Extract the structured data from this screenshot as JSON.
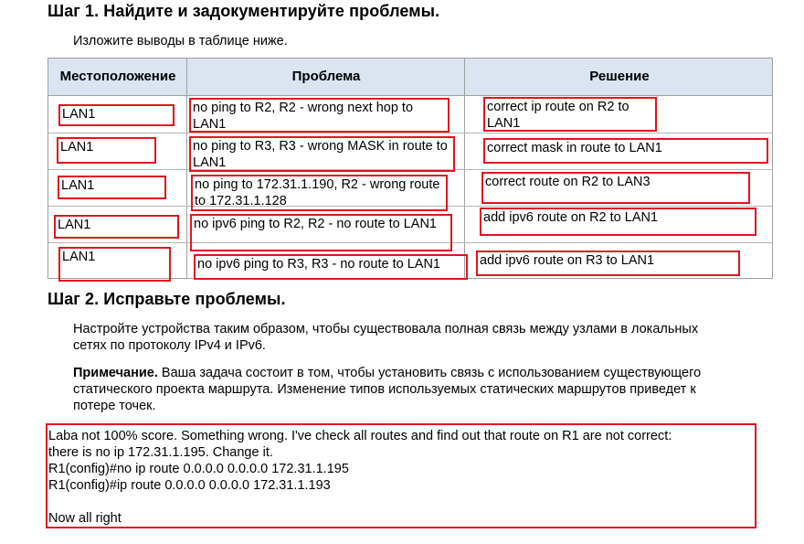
{
  "step1": {
    "title": "Шаг 1. Найдите и задокументируйте проблемы.",
    "instruction": "Изложите выводы в таблице ниже."
  },
  "table": {
    "headers": [
      "Местоположение",
      "Проблема",
      "Решение"
    ],
    "rows": [
      {
        "location": "LAN1",
        "problem": "no ping to R2, R2 - wrong next hop to LAN1",
        "solution": "correct ip route on R2 to LAN1"
      },
      {
        "location": "LAN1",
        "problem": "no ping to R3, R3 - wrong MASK in route to LAN1",
        "solution": "correct mask in route to LAN1"
      },
      {
        "location": "LAN1",
        "problem": "no ping to 172.31.1.190, R2 - wrong route to 172.31.1.128",
        "solution": "correct route on R2 to LAN3"
      },
      {
        "location": "LAN1",
        "problem": "no ipv6 ping to R2, R2 - no route to LAN1",
        "solution": "add ipv6 route on R2 to LAN1"
      },
      {
        "location": "LAN1",
        "problem": "no ipv6 ping to R3, R3 - no route to LAN1",
        "solution": "add ipv6 route on R3 to LAN1"
      }
    ]
  },
  "step2": {
    "title": "Шаг 2. Исправьте проблемы.",
    "para1_line1": "Настройте устройства таким образом, чтобы существовала полная связь между узлами в локальных",
    "para1_line2": "сетях по протоколу IPv4 и IPv6.",
    "note_label": "Примечание.",
    "note_line1": " Ваша задача состоит в том, чтобы установить связь с использованием существующего",
    "note_line2": "статического проекта маршрута. Изменение типов используемых статических маршрутов приведет к",
    "note_line3": "потере точек."
  },
  "comment": {
    "lines": [
      "Laba not 100% score. Something wrong. I've check all routes and find out that route on R1 are not correct:",
      "there is no ip 172.31.1.195. Change it.",
      "R1(config)#no ip route 0.0.0.0 0.0.0.0 172.31.1.195",
      "R1(config)#ip route 0.0.0.0 0.0.0.0 172.31.1.193",
      "",
      "Now all right"
    ]
  },
  "colors": {
    "annotation_border": "#e0141f",
    "header_bg": "#dbe5f1",
    "grid": "#9e9e9e"
  }
}
